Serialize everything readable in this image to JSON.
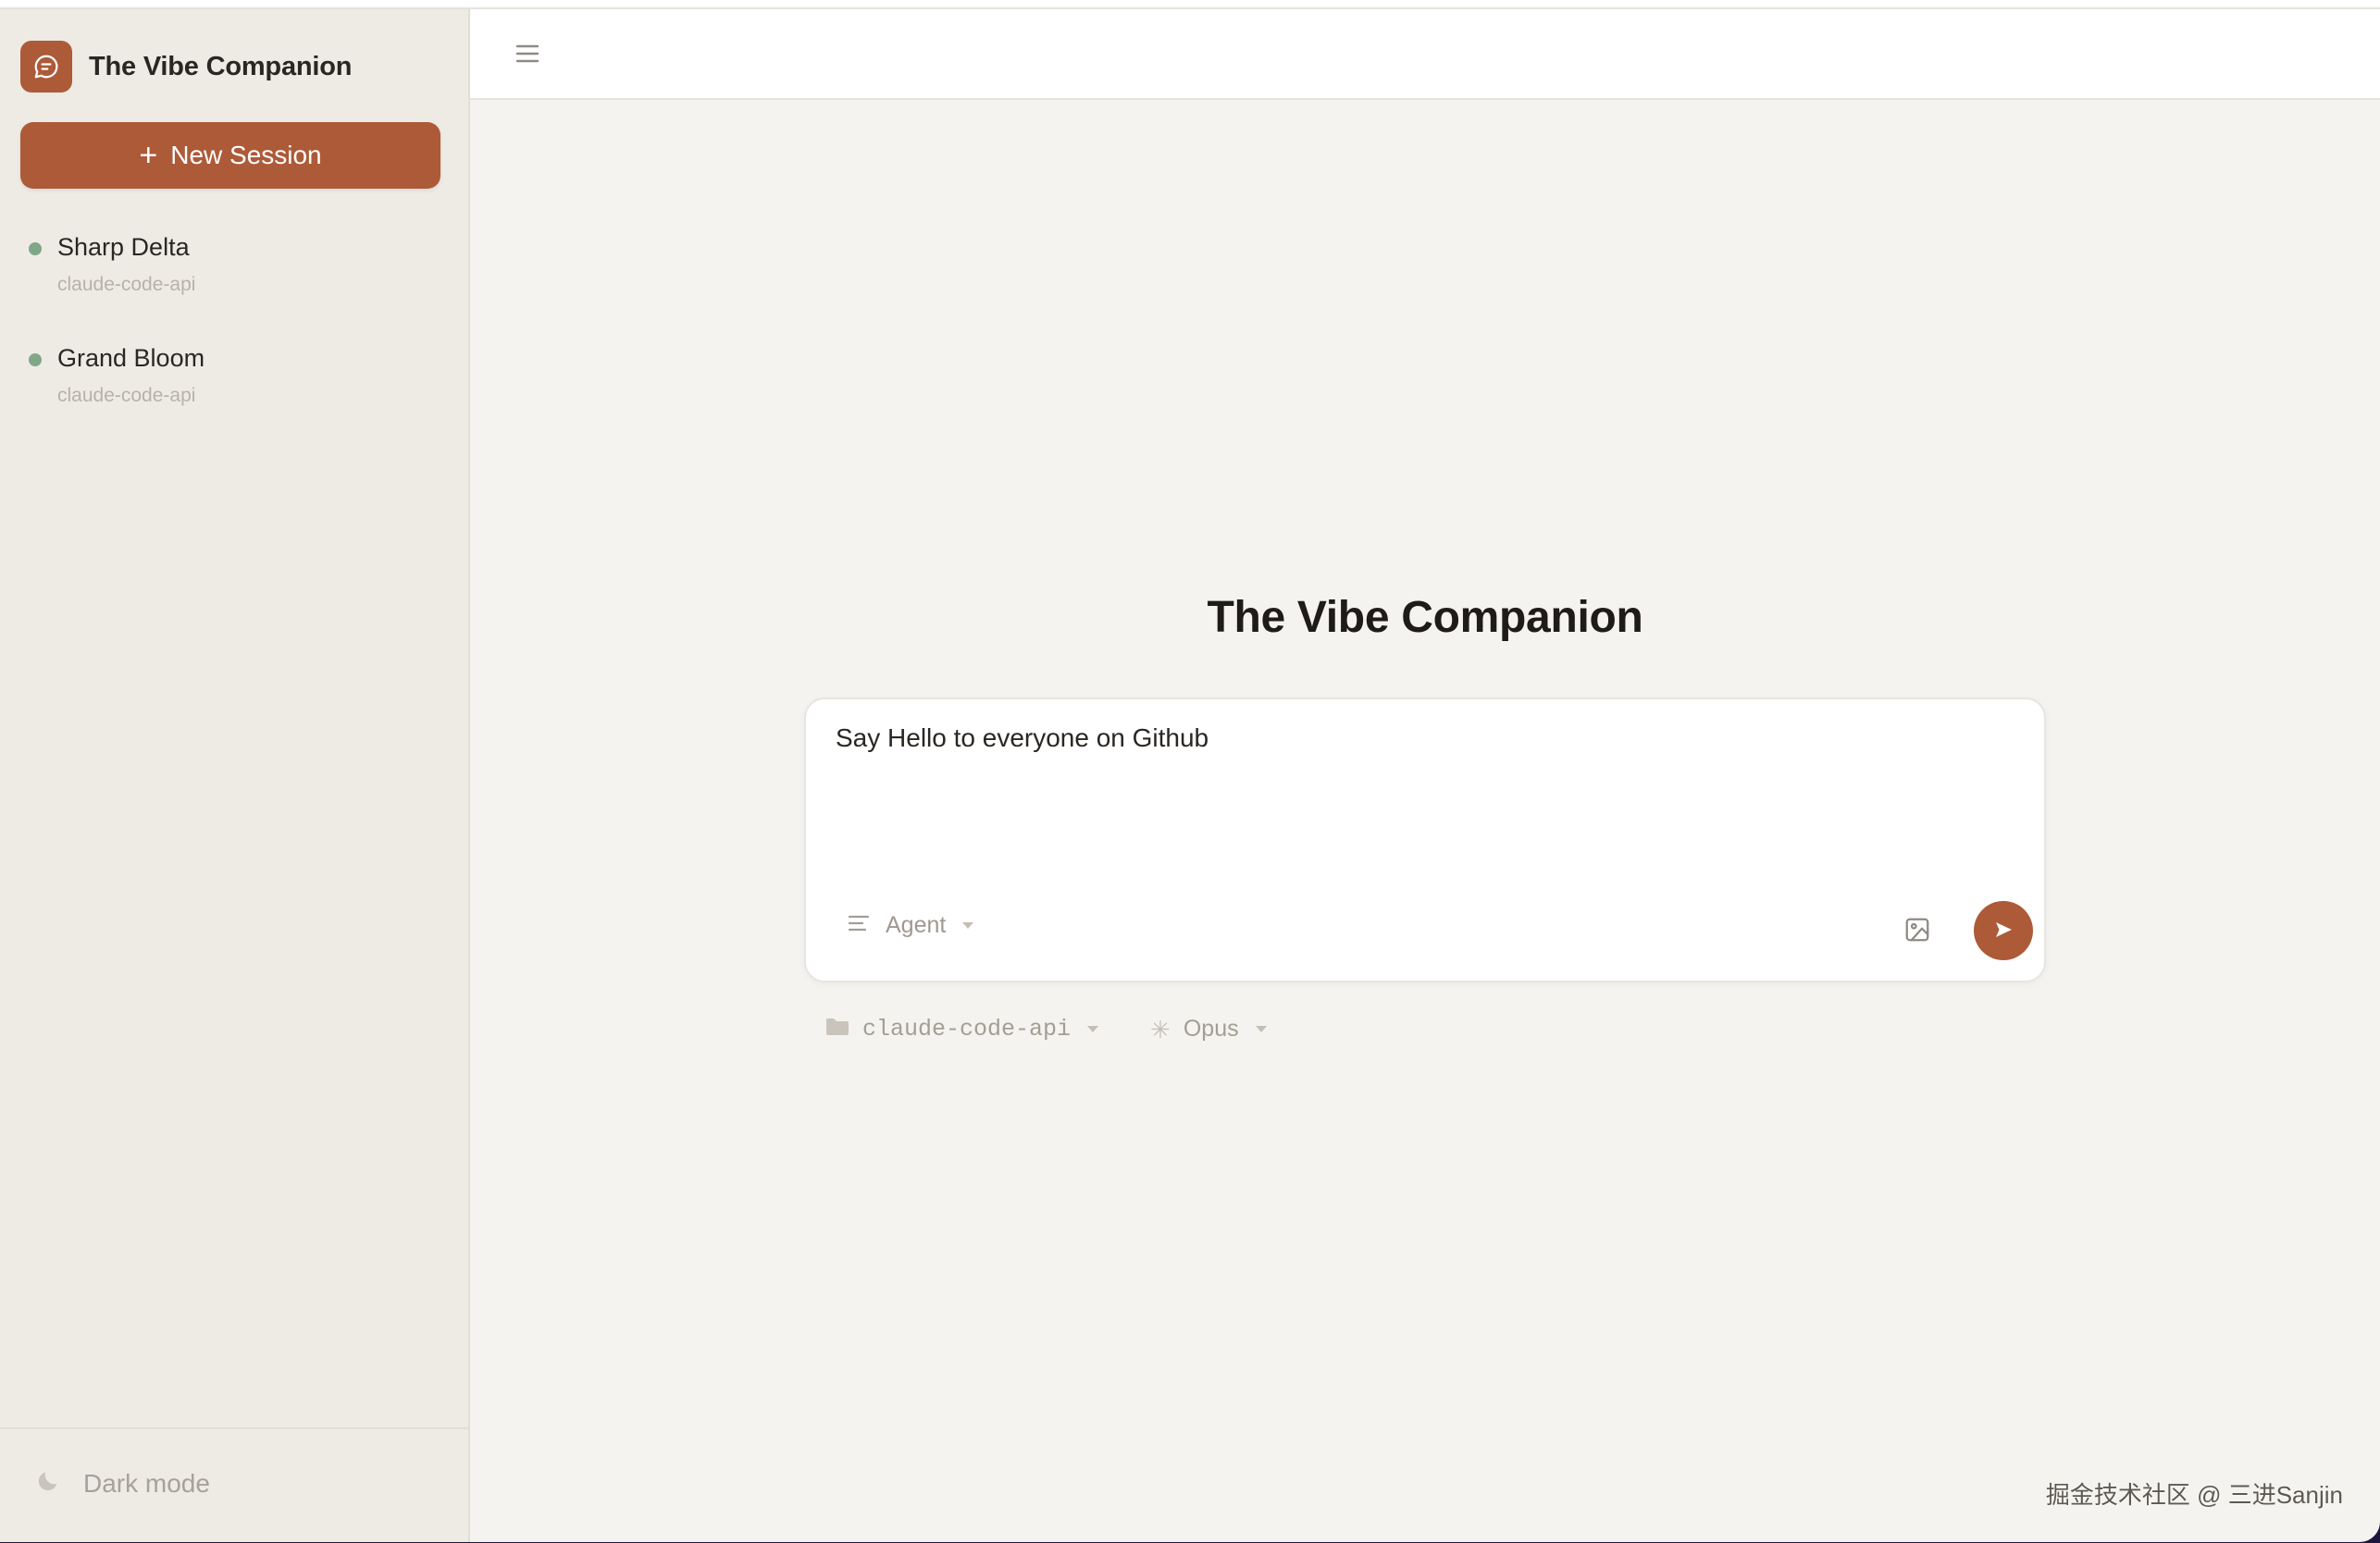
{
  "sidebar": {
    "brand_title": "The Vibe Companion",
    "new_session_label": "New Session",
    "sessions": [
      {
        "name": "Sharp Delta",
        "subtitle": "claude-code-api",
        "status_color": "#7fa788"
      },
      {
        "name": "Grand Bloom",
        "subtitle": "claude-code-api",
        "status_color": "#7fa788"
      }
    ],
    "dark_mode_label": "Dark mode"
  },
  "main": {
    "title": "The Vibe Companion",
    "composer": {
      "value": "Say Hello to everyone on Github",
      "mode_label": "Agent"
    },
    "options": {
      "folder_label": "claude-code-api",
      "model_label": "Opus"
    }
  },
  "watermark": "掘金技术社区 @ 三进Sanjin",
  "colors": {
    "accent": "#ad5a38",
    "sidebar_bg": "#eeebe5",
    "main_bg": "#f4f3ef",
    "status_dot": "#7fa788"
  }
}
